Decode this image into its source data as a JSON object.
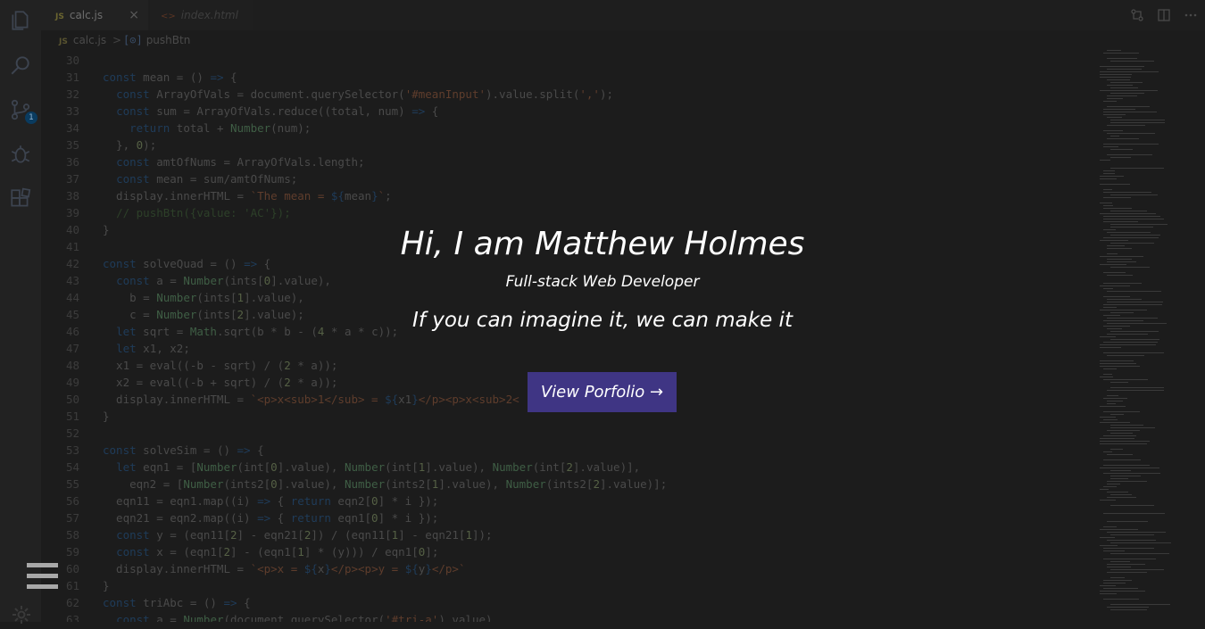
{
  "tabs": [
    {
      "icon": "JS",
      "label": "calc.js",
      "close": "×"
    },
    {
      "icon": "<>",
      "label": "index.html"
    }
  ],
  "breadcrumb": {
    "file_icon": "JS",
    "file": "calc.js",
    "separator": ">",
    "symbol_icon": "[⊙]",
    "symbol": "pushBtn"
  },
  "scm_badge": "1",
  "code_lines": [
    {
      "n": "30",
      "html": ""
    },
    {
      "n": "31",
      "html": "<span class='k'>const</span> mean = () <span class='k'>=&gt;</span> {"
    },
    {
      "n": "32",
      "html": "  <span class='k'>const</span> ArrayOfVals = document.querySelector(<span class='s'>'#meanInput'</span>).value.split(<span class='s'>','</span>);"
    },
    {
      "n": "33",
      "html": "  <span class='k'>const</span> sum = ArrayOfVals.reduce((total, num) <span class='k'>=&gt;</span> {"
    },
    {
      "n": "34",
      "html": "    <span class='k'>return</span> total + <span class='f'>Number</span>(num);"
    },
    {
      "n": "35",
      "html": "  }, <span class='n'>0</span>);"
    },
    {
      "n": "36",
      "html": "  <span class='k'>const</span> amtOfNums = ArrayOfVals.length;"
    },
    {
      "n": "37",
      "html": "  <span class='k'>const</span> mean = sum/amtOfNums;"
    },
    {
      "n": "38",
      "html": "  display.innerHTML = <span class='s'>`The mean = </span><span class='k'>${</span>mean<span class='k'>}</span><span class='s'>`</span>;"
    },
    {
      "n": "39",
      "html": "  <span class='c'>// pushBtn({value: 'AC'});</span>"
    },
    {
      "n": "40",
      "html": "}"
    },
    {
      "n": "41",
      "html": ""
    },
    {
      "n": "42",
      "html": "<span class='k'>const</span> solveQuad = () <span class='k'>=&gt;</span> {"
    },
    {
      "n": "43",
      "html": "  <span class='k'>const</span> a = <span class='f'>Number</span>(ints[<span class='n'>0</span>].value),"
    },
    {
      "n": "44",
      "html": "    b = <span class='f'>Number</span>(ints[<span class='n'>1</span>].value),"
    },
    {
      "n": "45",
      "html": "    c = <span class='f'>Number</span>(ints[<span class='n'>2</span>].value);"
    },
    {
      "n": "46",
      "html": "  <span class='k'>let</span> sqrt = <span class='f'>Math</span>.sqrt(b * b - (<span class='n'>4</span> * a * c));"
    },
    {
      "n": "47",
      "html": "  <span class='k'>let</span> x1, x2;"
    },
    {
      "n": "48",
      "html": "  x1 = eval((-b - sqrt) / (<span class='n'>2</span> * a));"
    },
    {
      "n": "49",
      "html": "  x2 = eval((-b + sqrt) / (<span class='n'>2</span> * a));"
    },
    {
      "n": "50",
      "html": "  display.innerHTML = <span class='s'>`&lt;p&gt;x&lt;sub&gt;1&lt;/sub&gt; = </span><span class='k'>${</span>x1<span class='k'>}</span><span class='s'>&lt;/p&gt;&lt;p&gt;x&lt;sub&gt;2&lt;</span>"
    },
    {
      "n": "51",
      "html": "}"
    },
    {
      "n": "52",
      "html": ""
    },
    {
      "n": "53",
      "html": "<span class='k'>const</span> solveSim = () <span class='k'>=&gt;</span> {"
    },
    {
      "n": "54",
      "html": "  <span class='k'>let</span> eqn1 = [<span class='f'>Number</span>(int[<span class='n'>0</span>].value), <span class='f'>Number</span>(int[<span class='n'>1</span>].value), <span class='f'>Number</span>(int[<span class='n'>2</span>].value)],"
    },
    {
      "n": "55",
      "html": "    eqn2 = [<span class='f'>Number</span>(ints2[<span class='n'>0</span>].value), <span class='f'>Number</span>(ints2[<span class='n'>1</span>].value), <span class='f'>Number</span>(ints2[<span class='n'>2</span>].value)];"
    },
    {
      "n": "56",
      "html": "  eqn11 = eqn1.map((i) <span class='k'>=&gt;</span> { <span class='k'>return</span> eqn2[<span class='n'>0</span>] * i });"
    },
    {
      "n": "57",
      "html": "  eqn21 = eqn2.map((i) <span class='k'>=&gt;</span> { <span class='k'>return</span> eqn1[<span class='n'>0</span>] * i });"
    },
    {
      "n": "58",
      "html": "  <span class='k'>const</span> y = (eqn11[<span class='n'>2</span>] - eqn21[<span class='n'>2</span>]) / (eqn11[<span class='n'>1</span>] - eqn21[<span class='n'>1</span>]);"
    },
    {
      "n": "59",
      "html": "  <span class='k'>const</span> x = (eqn1[<span class='n'>2</span>] - (eqn1[<span class='n'>1</span>] * (y))) / eqn1[<span class='n'>0</span>];"
    },
    {
      "n": "60",
      "html": "  display.innerHTML = <span class='s'>`&lt;p&gt;x = </span><span class='k'>${</span>x<span class='k'>}</span><span class='s'>&lt;/p&gt;&lt;p&gt;y = </span><span class='k'>${</span>y<span class='k'>}</span><span class='s'>&lt;/p&gt;`</span>"
    },
    {
      "n": "61",
      "html": "}"
    },
    {
      "n": "62",
      "html": "<span class='k'>const</span> triAbc = () <span class='k'>=&gt;</span> {"
    },
    {
      "n": "63",
      "html": "  <span class='k'>const</span> a = <span class='f'>Number</span>(document.querySelector(<span class='s'>'#tri-a'</span>).value)"
    }
  ],
  "hero": {
    "title": "Hi, I am Matthew Holmes",
    "subtitle": "Full-stack Web Developer",
    "tagline": "If you can imagine it, we can make it",
    "cta_label": "View Porfolio →"
  }
}
